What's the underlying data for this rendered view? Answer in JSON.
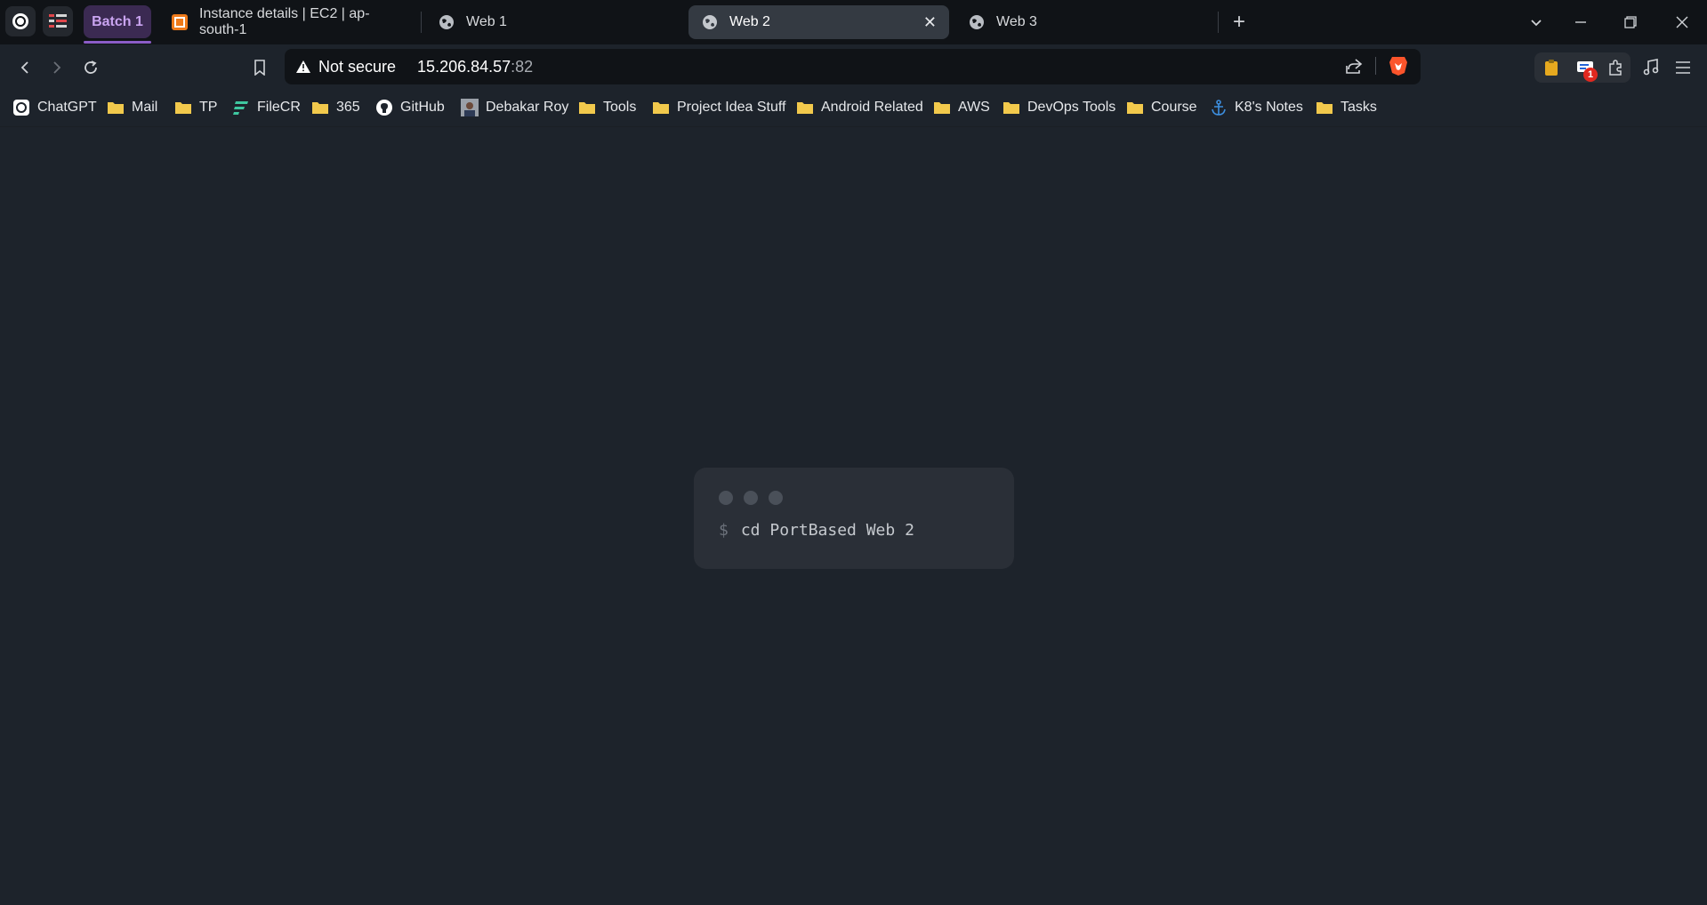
{
  "browser": {
    "tab_group": {
      "label": "Batch 1"
    },
    "tabs": [
      {
        "title": "Instance details | EC2 | ap-south-1",
        "favicon": "aws-ec2-icon",
        "active": false
      },
      {
        "title": "Web 1",
        "favicon": "globe-icon",
        "active": false
      },
      {
        "title": "Web 2",
        "favicon": "globe-icon",
        "active": true
      },
      {
        "title": "Web 3",
        "favicon": "globe-icon",
        "active": false
      }
    ],
    "new_tab_label": "+",
    "address_bar": {
      "security_label": "Not secure",
      "host": "15.206.84.57",
      "port": ":82"
    },
    "extensions": {
      "badge_count": "1"
    },
    "bookmarks": [
      {
        "label": "ChatGPT",
        "icon": "chatgpt-icon"
      },
      {
        "label": "Mail",
        "icon": "folder-icon"
      },
      {
        "label": "TP",
        "icon": "folder-icon"
      },
      {
        "label": "FileCR",
        "icon": "filecr-icon"
      },
      {
        "label": "365",
        "icon": "folder-icon"
      },
      {
        "label": "GitHub",
        "icon": "github-icon"
      },
      {
        "label": "Debakar Roy",
        "icon": "avatar-icon"
      },
      {
        "label": "Tools",
        "icon": "folder-icon"
      },
      {
        "label": "Project Idea Stuff",
        "icon": "folder-icon"
      },
      {
        "label": "Android Related",
        "icon": "folder-icon"
      },
      {
        "label": "AWS",
        "icon": "folder-icon"
      },
      {
        "label": "DevOps Tools",
        "icon": "folder-icon"
      },
      {
        "label": "Course",
        "icon": "folder-icon"
      },
      {
        "label": "K8's Notes",
        "icon": "anchor-icon"
      },
      {
        "label": "Tasks",
        "icon": "folder-icon"
      }
    ],
    "colors": {
      "page_bg": "#1d232b",
      "tab_strip_bg": "#101317",
      "tab_group_accent": "#8b5cc7",
      "folder": "#f2c94c"
    }
  },
  "page": {
    "terminal": {
      "prompt": "$",
      "command": "cd PortBased Web 2"
    }
  }
}
